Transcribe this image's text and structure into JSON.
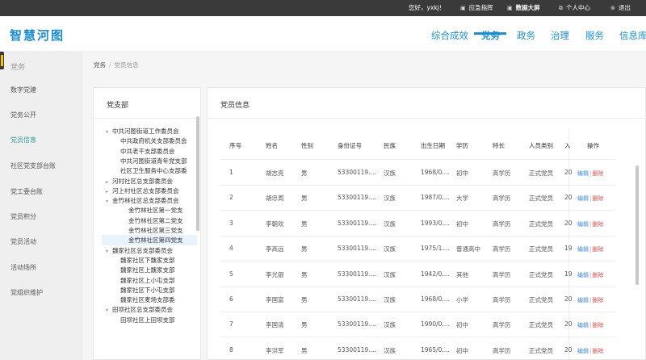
{
  "topbar": {
    "greeting": "您好，yxkj！",
    "guide": "应急指挥",
    "data_screen": "数据大屏",
    "personal_center": "个人中心",
    "logout": "退出"
  },
  "header": {
    "logo": "智慧河图",
    "nav": [
      "综合成效",
      "党务",
      "政务",
      "治理",
      "服务",
      "信息库"
    ],
    "active_nav": "党务"
  },
  "sidebar": {
    "title": "党务",
    "items": [
      "数字党建",
      "党务公开",
      "党员信息",
      "社区党支部台账",
      "党工委台账",
      "党员积分",
      "党员活动",
      "活动场所",
      "党组织维护"
    ],
    "active_item": "党员信息"
  },
  "breadcrumb": {
    "root": "党务",
    "current": "党员信息"
  },
  "tree_panel": {
    "title": "党支部",
    "nodes": [
      {
        "label": "中共河图街道工作委员会",
        "arrow": "▾"
      },
      {
        "label": "中共政府机关支部委员会",
        "arrow": ""
      },
      {
        "label": "中共老干支部委员会",
        "arrow": ""
      },
      {
        "label": "中共河图街道青年党支部",
        "arrow": ""
      },
      {
        "label": "社区卫生服务中心支部委",
        "arrow": ""
      },
      {
        "label": "河村社区总支部委员会",
        "arrow": "▸"
      },
      {
        "label": "河上村社区总支部委员会",
        "arrow": "▸"
      },
      {
        "label": "金竹林社区总支部委员会",
        "arrow": "▾"
      },
      {
        "label": "金竹林社区第一党支",
        "arrow": ""
      },
      {
        "label": "金竹林社区第二党支",
        "arrow": ""
      },
      {
        "label": "金竹林社区第三党支",
        "arrow": ""
      },
      {
        "label": "金竹林社区第四党支",
        "arrow": ""
      },
      {
        "label": "魏家社区总支部委员会",
        "arrow": "▾"
      },
      {
        "label": "魏家社区下魏家支部",
        "arrow": ""
      },
      {
        "label": "魏家社区上魏家支部",
        "arrow": ""
      },
      {
        "label": "魏家社区上小屯支部",
        "arrow": ""
      },
      {
        "label": "魏家社区下小屯支部",
        "arrow": ""
      },
      {
        "label": "魏家社区麦场支部委",
        "arrow": ""
      },
      {
        "label": "田坝社区总支部委员会",
        "arrow": "▾"
      },
      {
        "label": "田坝社区上田坝支部",
        "arrow": ""
      }
    ],
    "selected": "金竹林社区第四党支"
  },
  "member_panel": {
    "title": "党员信息",
    "columns": [
      "序号",
      "姓名",
      "性别",
      "身份证号",
      "民族",
      "出生日期",
      "学历",
      "特长",
      "人员类别",
      "入",
      "操作"
    ],
    "edit_label": "编辑",
    "delete_label": "删除",
    "rows": [
      [
        "1",
        "胡志亮",
        "男",
        "53300119....",
        "汉族",
        "1968/0....",
        "初中",
        "高学历",
        "正式党员",
        "20"
      ],
      [
        "2",
        "胡忠周",
        "男",
        "53300119....",
        "汉族",
        "1987/0....",
        "大学",
        "高学历",
        "正式党员",
        "20"
      ],
      [
        "3",
        "李朝欢",
        "男",
        "53300119....",
        "汉族",
        "1993/0....",
        "初中",
        "高学历",
        "正式党员",
        "20"
      ],
      [
        "4",
        "李高远",
        "男",
        "53300119....",
        "汉族",
        "1975/1....",
        "普通高中",
        "高学历",
        "正式党员",
        "19"
      ],
      [
        "5",
        "李光银",
        "男",
        "53300119....",
        "汉族",
        "1942/0....",
        "其他",
        "高学历",
        "正式党员",
        "19"
      ],
      [
        "6",
        "李国富",
        "男",
        "53300119....",
        "汉族",
        "1968/0....",
        "小学",
        "高学历",
        "正式党员",
        "20"
      ],
      [
        "7",
        "李国清",
        "男",
        "53300119....",
        "汉族",
        "1990/0....",
        "初中",
        "高学历",
        "正式党员",
        "20"
      ],
      [
        "8",
        "李洪军",
        "男",
        "53300119....",
        "汉族",
        "1965/0....",
        "初中",
        "高学历",
        "正式党员",
        "20"
      ]
    ]
  },
  "colors": {
    "accent": "#1a8fd6",
    "sidebar_active": "#2a9d8f",
    "edit": "#3d8de0",
    "delete": "#e05050",
    "topbar": "#3a3a3a"
  }
}
